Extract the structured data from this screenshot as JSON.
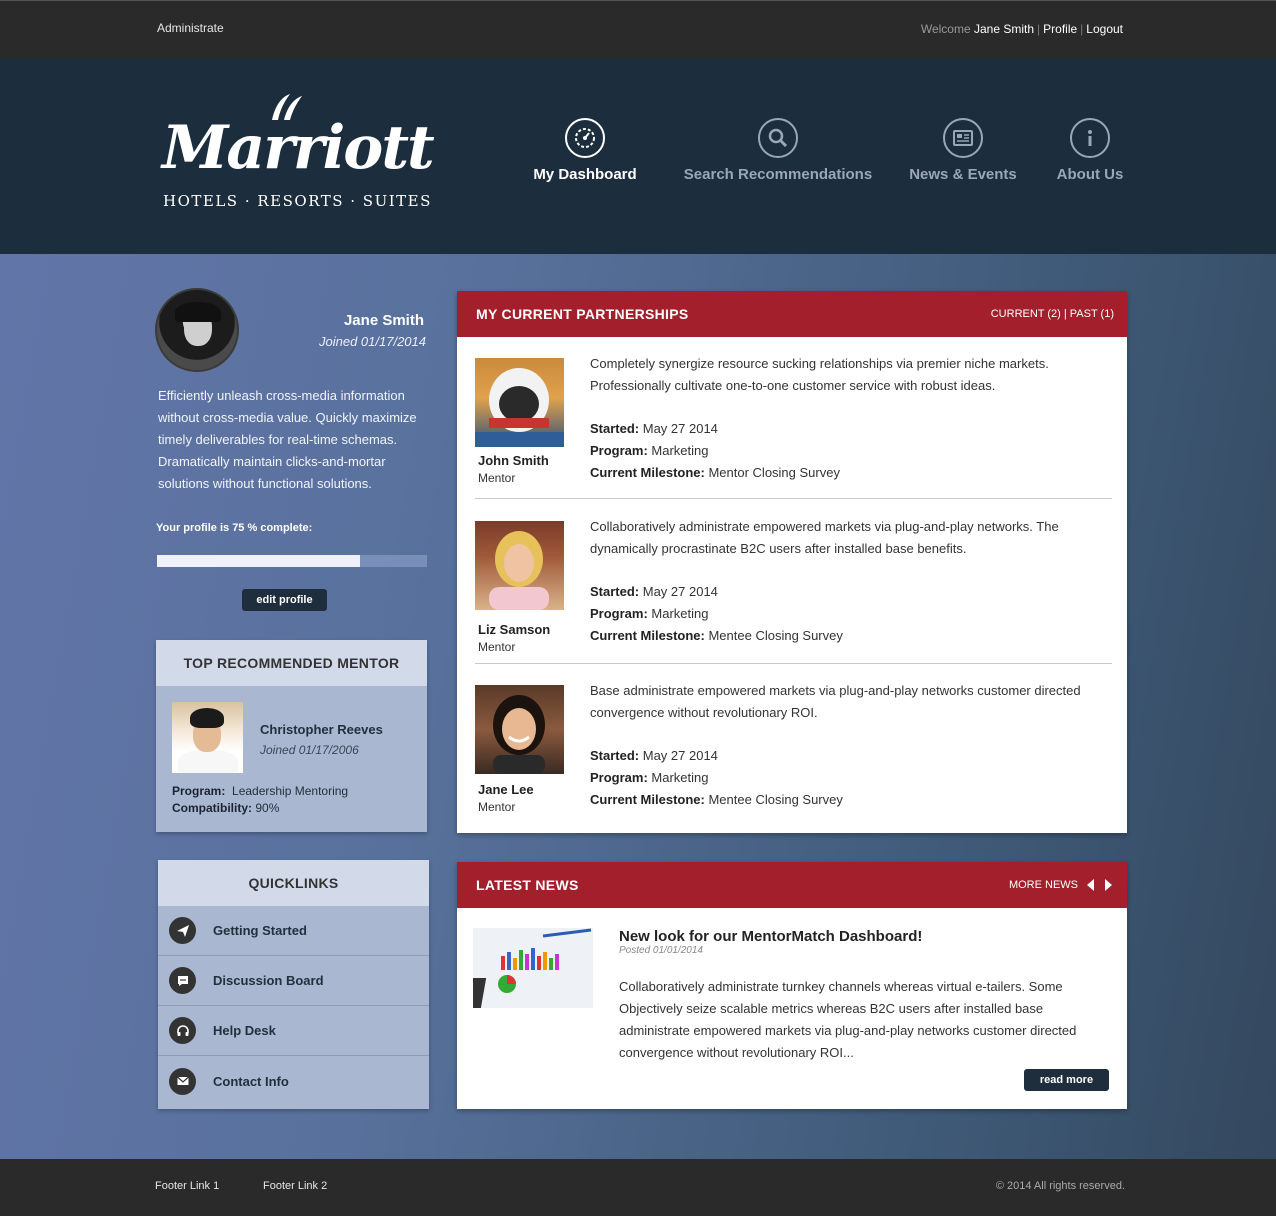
{
  "topbar": {
    "admin_label": "Administrate",
    "welcome_label": "Welcome",
    "user_name": "Jane Smith",
    "profile_link": "Profile",
    "logout_link": "Logout",
    "separator": "|"
  },
  "brand": {
    "name": "Marriott",
    "tagline": "HOTELS · RESORTS · SUITES"
  },
  "nav": {
    "items": [
      {
        "label": "My Dashboard",
        "icon": "speedometer-icon",
        "active": true
      },
      {
        "label": "Search Recommendations",
        "icon": "search-icon",
        "active": false
      },
      {
        "label": "News & Events",
        "icon": "newspaper-icon",
        "active": false
      },
      {
        "label": "About Us",
        "icon": "info-icon",
        "active": false
      }
    ]
  },
  "profile": {
    "name": "Jane Smith",
    "joined": "Joined 01/17/2014",
    "bio": "Efficiently unleash cross-media information without cross-media value. Quickly maximize timely deliverables for real-time schemas. Dramatically maintain clicks-and-mortar solutions without functional solutions.",
    "completion_label": "Your profile is 75 % complete:",
    "completion_percent": 75,
    "edit_button": "edit profile"
  },
  "top_mentor": {
    "heading": "TOP RECOMMENDED MENTOR",
    "name": "Christopher Reeves",
    "joined": "Joined 01/17/2006",
    "program_label": "Program:",
    "program_value": "Leadership Mentoring",
    "compat_label": "Compatibility:",
    "compat_value": "90%"
  },
  "quicklinks": {
    "heading": "QUICKLINKS",
    "items": [
      {
        "label": "Getting Started",
        "icon": "paper-plane-icon"
      },
      {
        "label": "Discussion Board",
        "icon": "chat-bubble-icon"
      },
      {
        "label": "Help Desk",
        "icon": "headset-icon"
      },
      {
        "label": "Contact Info",
        "icon": "envelope-icon"
      }
    ]
  },
  "partnerships": {
    "heading": "MY CURRENT PARTNERSHIPS",
    "filter": "CURRENT (2) | PAST (1)",
    "started_label": "Started:",
    "program_label": "Program:",
    "milestone_label": "Current Milestone:",
    "items": [
      {
        "name": "John Smith",
        "role": "Mentor",
        "description": "Completely synergize resource sucking relationships via premier niche markets. Professionally cultivate one-to-one customer service with robust ideas.",
        "started": "May 27 2014",
        "program": "Marketing",
        "milestone": "Mentor Closing Survey"
      },
      {
        "name": "Liz Samson",
        "role": "Mentor",
        "description": "Collaboratively administrate empowered markets via plug-and-play networks. The dynamically procrastinate B2C users after installed base benefits.",
        "started": "May 27 2014",
        "program": "Marketing",
        "milestone": "Mentee Closing Survey"
      },
      {
        "name": "Jane Lee",
        "role": "Mentor",
        "description": "Base administrate empowered markets via plug-and-play networks  customer directed convergence without revolutionary ROI.",
        "started": "May 27 2014",
        "program": "Marketing",
        "milestone": "Mentee Closing Survey"
      }
    ]
  },
  "news": {
    "heading": "LATEST NEWS",
    "more_label": "MORE NEWS",
    "title": "New look for our MentorMatch Dashboard!",
    "posted": "Posted 01/01/2014",
    "body": "Collaboratively administrate turnkey channels whereas virtual e-tailers. Some Objectively seize scalable metrics whereas B2C users after installed base administrate empowered markets via plug-and-play networks  customer directed convergence without revolutionary ROI...",
    "read_more": "read more"
  },
  "footer": {
    "link1": "Footer Link 1",
    "link2": "Footer Link 2",
    "copyright": "© 2014 All rights reserved."
  },
  "colors": {
    "header_bg": "#1c2d3e",
    "accent_red": "#a31f2b",
    "button_dark": "#1f2e3d",
    "panel_light": "#a9b7d1"
  }
}
